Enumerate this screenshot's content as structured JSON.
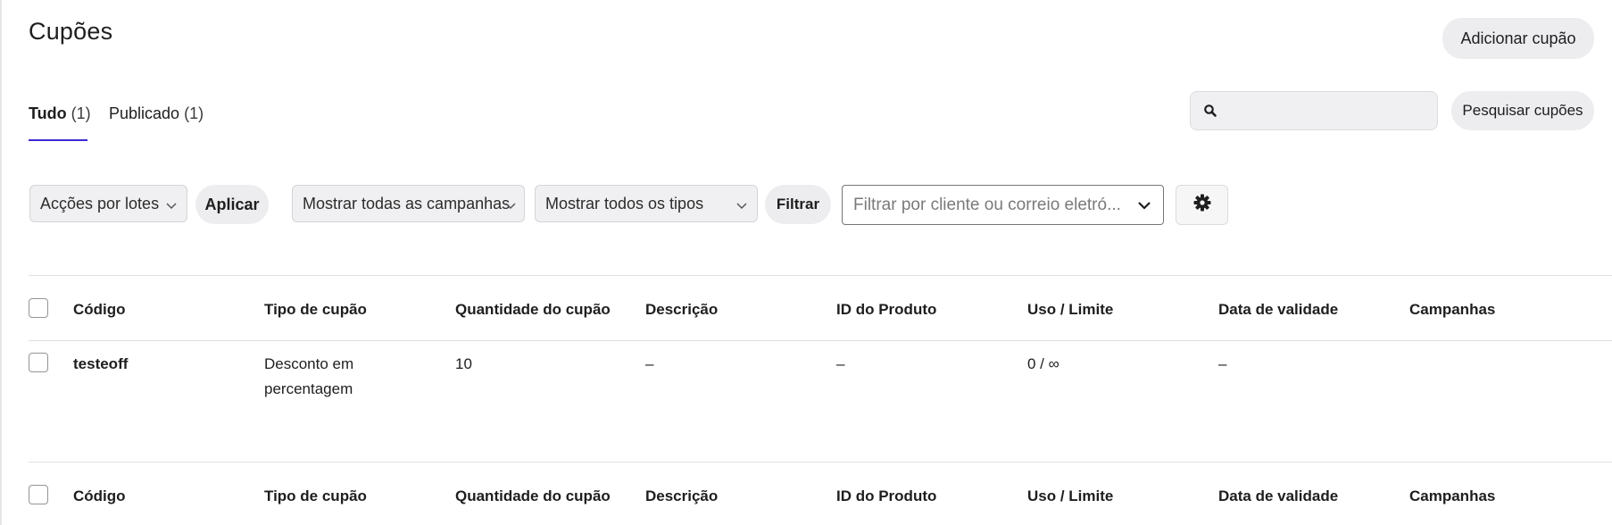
{
  "page": {
    "title": "Cupões",
    "add_button": "Adicionar cupão"
  },
  "tabs": [
    {
      "label": "Tudo",
      "count": "(1)"
    },
    {
      "label": "Publicado",
      "count": "(1)"
    }
  ],
  "search": {
    "value": "",
    "button": "Pesquisar cupões"
  },
  "filters": {
    "bulk_actions": "Acções por lotes",
    "apply": "Aplicar",
    "campaigns": "Mostrar todas as campanhas",
    "types": "Mostrar todos os tipos",
    "filter": "Filtrar",
    "customer_placeholder": "Filtrar por cliente ou correio eletró..."
  },
  "table": {
    "columns": [
      "Código",
      "Tipo de cupão",
      "Quantidade do cupão",
      "Descrição",
      "ID do Produto",
      "Uso / Limite",
      "Data de validade",
      "Campanhas"
    ],
    "rows": [
      {
        "code": "testeoff",
        "type_line1": "Desconto em",
        "type_line2": "percentagem",
        "amount": "10",
        "description": "–",
        "product_ids": "–",
        "usage": "0 / ∞",
        "expiry": "–",
        "campaigns": ""
      }
    ]
  },
  "colors": {
    "accent": "#3d2bd6",
    "button_bg": "#ededf0",
    "border": "#e0e0e0"
  },
  "icons": {
    "search": "search-icon",
    "chevron": "chevron-down-icon",
    "settings": "gear-icon"
  }
}
